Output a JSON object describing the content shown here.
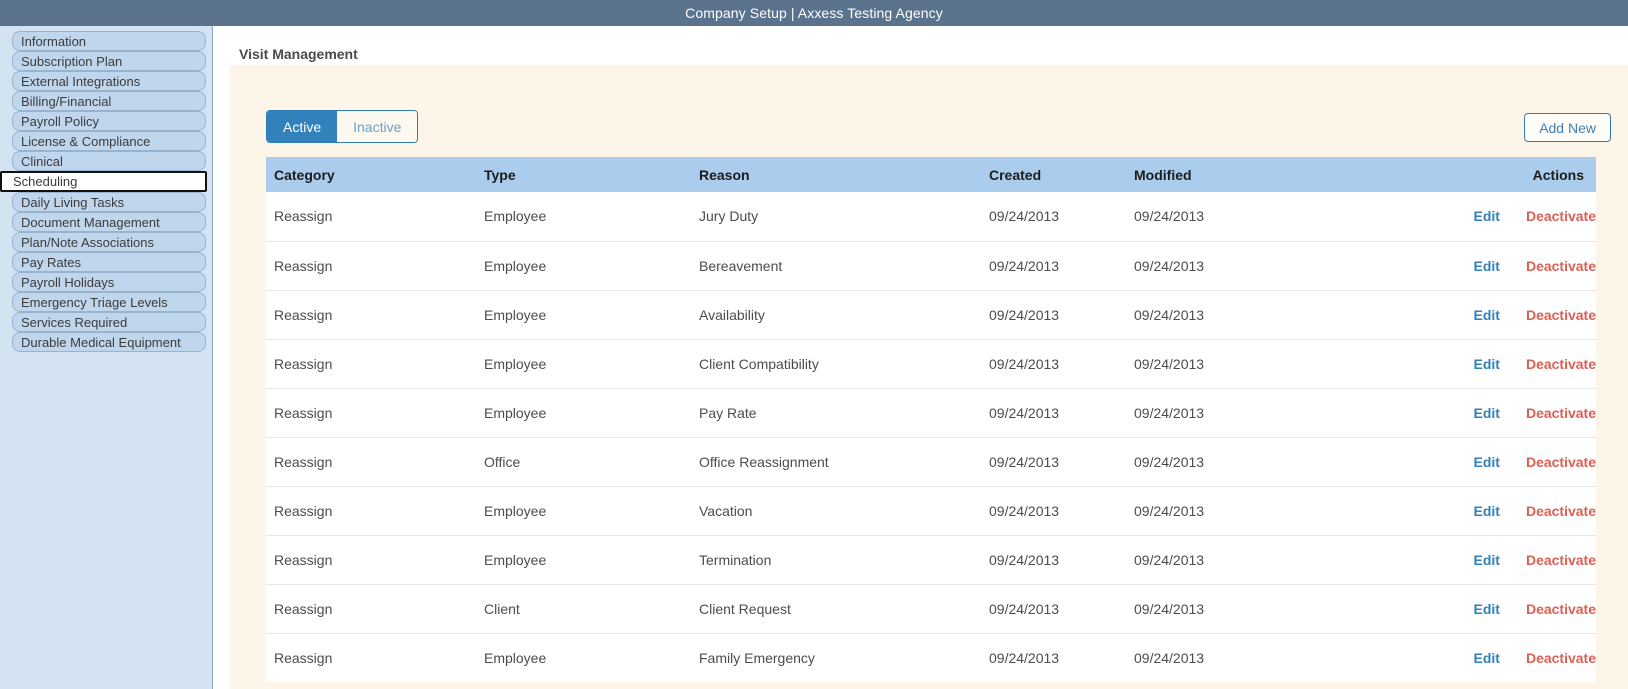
{
  "window": {
    "title": "Company Setup | Axxess Testing Agency"
  },
  "sidebar": {
    "items": [
      {
        "label": "Information",
        "selected": false
      },
      {
        "label": "Subscription Plan",
        "selected": false
      },
      {
        "label": "External Integrations",
        "selected": false
      },
      {
        "label": "Billing/Financial",
        "selected": false
      },
      {
        "label": "Payroll Policy",
        "selected": false
      },
      {
        "label": "License & Compliance",
        "selected": false
      },
      {
        "label": "Clinical",
        "selected": false
      },
      {
        "label": "Scheduling",
        "selected": true
      },
      {
        "label": "Daily Living Tasks",
        "selected": false
      },
      {
        "label": "Document Management",
        "selected": false
      },
      {
        "label": "Plan/Note Associations",
        "selected": false
      },
      {
        "label": "Pay Rates",
        "selected": false
      },
      {
        "label": "Payroll Holidays",
        "selected": false
      },
      {
        "label": "Emergency Triage Levels",
        "selected": false
      },
      {
        "label": "Services Required",
        "selected": false
      },
      {
        "label": "Durable Medical Equipment",
        "selected": false
      }
    ]
  },
  "main": {
    "page_title": "Visit Management",
    "tabs": [
      {
        "label": "Active",
        "active": true
      },
      {
        "label": "Inactive",
        "active": false
      }
    ],
    "add_new_label": "Add New",
    "table": {
      "columns": [
        "Category",
        "Type",
        "Reason",
        "Created",
        "Modified",
        "Actions"
      ],
      "action_labels": {
        "edit": "Edit",
        "deactivate": "Deactivate"
      },
      "rows": [
        {
          "category": "Reassign",
          "type": "Employee",
          "reason": "Jury Duty",
          "created": "09/24/2013",
          "modified": "09/24/2013"
        },
        {
          "category": "Reassign",
          "type": "Employee",
          "reason": "Bereavement",
          "created": "09/24/2013",
          "modified": "09/24/2013"
        },
        {
          "category": "Reassign",
          "type": "Employee",
          "reason": "Availability",
          "created": "09/24/2013",
          "modified": "09/24/2013"
        },
        {
          "category": "Reassign",
          "type": "Employee",
          "reason": "Client Compatibility",
          "created": "09/24/2013",
          "modified": "09/24/2013"
        },
        {
          "category": "Reassign",
          "type": "Employee",
          "reason": "Pay Rate",
          "created": "09/24/2013",
          "modified": "09/24/2013"
        },
        {
          "category": "Reassign",
          "type": "Office",
          "reason": "Office Reassignment",
          "created": "09/24/2013",
          "modified": "09/24/2013"
        },
        {
          "category": "Reassign",
          "type": "Employee",
          "reason": "Vacation",
          "created": "09/24/2013",
          "modified": "09/24/2013"
        },
        {
          "category": "Reassign",
          "type": "Employee",
          "reason": "Termination",
          "created": "09/24/2013",
          "modified": "09/24/2013"
        },
        {
          "category": "Reassign",
          "type": "Client",
          "reason": "Client Request",
          "created": "09/24/2013",
          "modified": "09/24/2013"
        },
        {
          "category": "Reassign",
          "type": "Employee",
          "reason": "Family Emergency",
          "created": "09/24/2013",
          "modified": "09/24/2013"
        }
      ]
    }
  },
  "colors": {
    "titlebar": "#5a728c",
    "sidebar_bg": "#d4e3f2",
    "sidebar_item": "#bfd6ec",
    "panel_bg": "#fdf5e8",
    "tab_active": "#3281ba",
    "table_header": "#aacdee",
    "link_edit": "#3281ba",
    "link_deactivate": "#dc5f54"
  }
}
